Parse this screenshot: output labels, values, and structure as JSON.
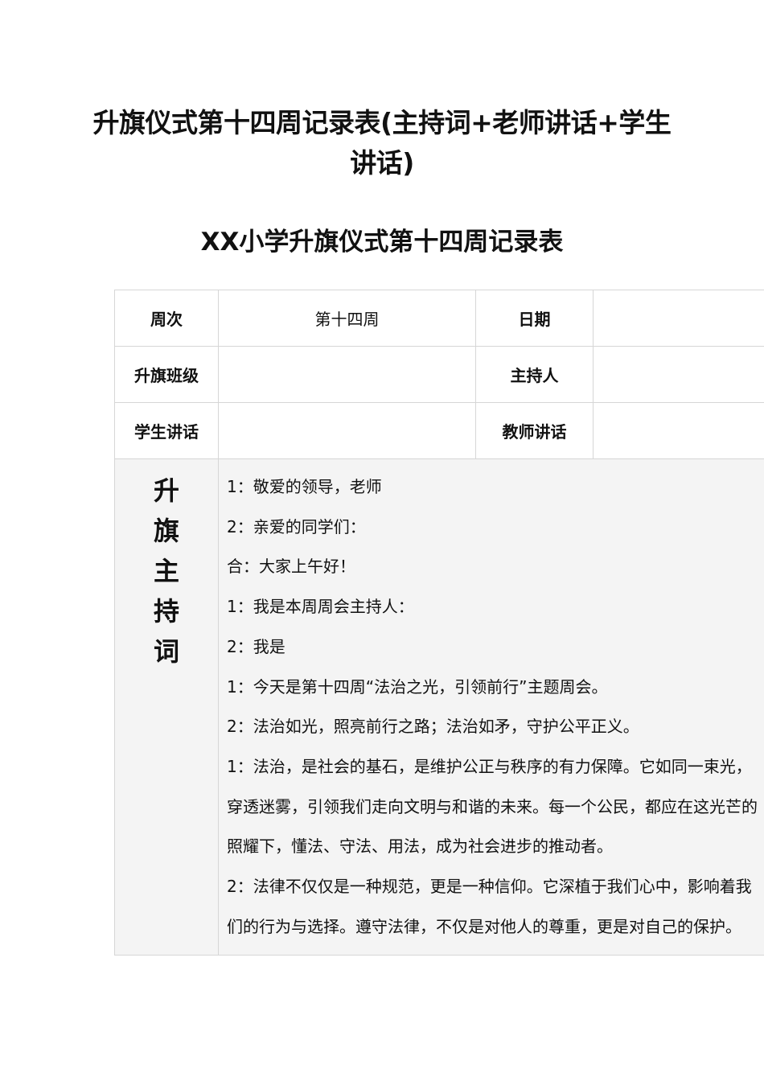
{
  "document": {
    "title": "升旗仪式第十四周记录表(主持词+老师讲话+学生讲话)",
    "table_title": "XX小学升旗仪式第十四周记录表"
  },
  "table": {
    "row1": {
      "week_label": "周次",
      "week_value": "第十四周",
      "date_label": "日期",
      "date_value": ""
    },
    "row2": {
      "class_label": "升旗班级",
      "class_value": "",
      "host_label": "主持人",
      "host_value": ""
    },
    "row3": {
      "student_speech_label": "学生讲话",
      "student_speech_value": "",
      "teacher_speech_label": "教师讲话",
      "teacher_speech_value": ""
    },
    "host_script": {
      "label": "升旗主持词",
      "lines": [
        "1：敬爱的领导，老师",
        "2：亲爱的同学们：",
        "合：大家上午好！",
        "1：我是本周周会主持人：",
        "2：我是",
        "1：今天是第十四周“法治之光，引领前行”主题周会。",
        "2：法治如光，照亮前行之路；法治如矛，守护公平正义。",
        "1：法治，是社会的基石，是维护公正与秩序的有力保障。它如同一束光，",
        "穿透迷雾，引领我们走向文明与和谐的未来。每一个公民，都应在这光芒的",
        "照耀下，懂法、守法、用法，成为社会进步的推动者。",
        "2：法律不仅仅是一种规范，更是一种信仰。它深植于我们心中，影响着我",
        "们的行为与选择。遵守法律，不仅是对他人的尊重，更是对自己的保护。"
      ]
    }
  }
}
